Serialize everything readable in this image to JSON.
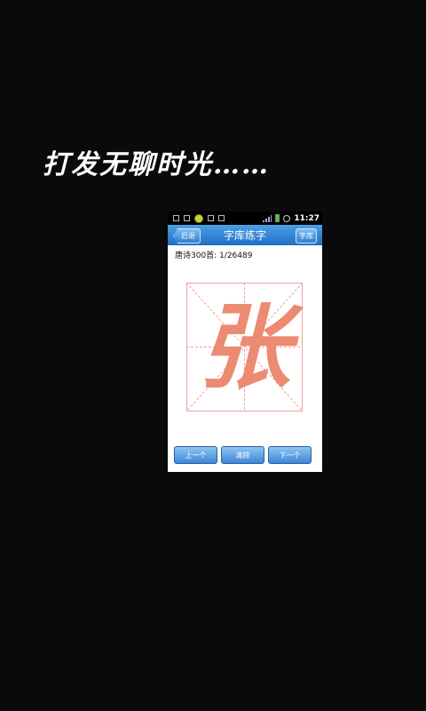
{
  "promo_text": "打发无聊时光……",
  "status": {
    "time": "11:27"
  },
  "header": {
    "title": "字库练字",
    "back_label": "后退",
    "library_label": "字库"
  },
  "info_line": "唐诗300首: 1/26489",
  "practice": {
    "character": "张"
  },
  "buttons": {
    "prev": "上一个",
    "clear": "清除",
    "next": "下一个"
  },
  "colors": {
    "accent": "#1f6fc4",
    "stroke": "#ec8a72",
    "grid": "#f0a0a0"
  }
}
